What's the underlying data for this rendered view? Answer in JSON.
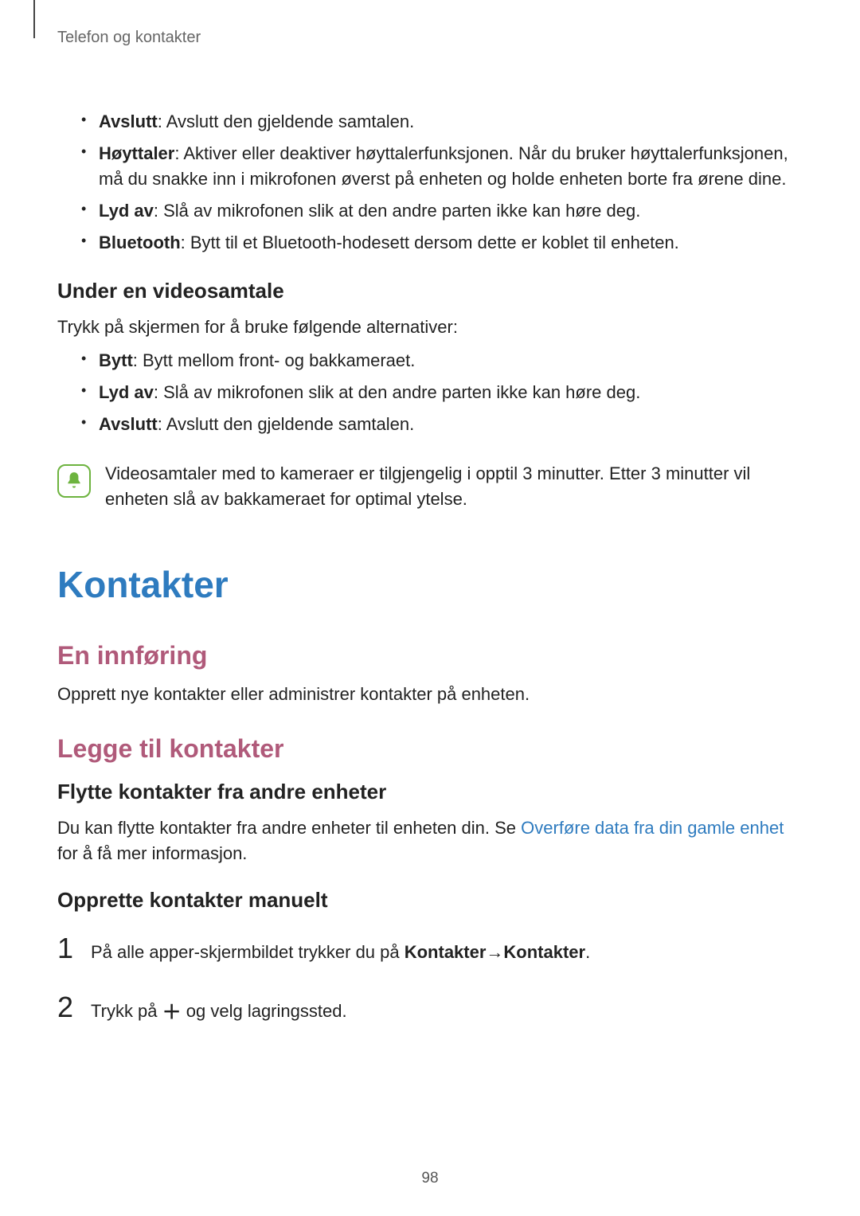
{
  "breadcrumb": "Telefon og kontakter",
  "call_bullets": [
    {
      "bold": "Avslutt",
      "rest": ": Avslutt den gjeldende samtalen."
    },
    {
      "bold": "Høyttaler",
      "rest": ": Aktiver eller deaktiver høyttalerfunksjonen. Når du bruker høyttalerfunksjonen, må du snakke inn i mikrofonen øverst på enheten og holde enheten borte fra ørene dine."
    },
    {
      "bold": "Lyd av",
      "rest": ": Slå av mikrofonen slik at den andre parten ikke kan høre deg."
    },
    {
      "bold": "Bluetooth",
      "rest": ": Bytt til et Bluetooth-hodesett dersom dette er koblet til enheten."
    }
  ],
  "video_heading": "Under en videosamtale",
  "video_intro": "Trykk på skjermen for å bruke følgende alternativer:",
  "video_bullets": [
    {
      "bold": "Bytt",
      "rest": ": Bytt mellom front- og bakkameraet."
    },
    {
      "bold": "Lyd av",
      "rest": ": Slå av mikrofonen slik at den andre parten ikke kan høre deg."
    },
    {
      "bold": "Avslutt",
      "rest": ": Avslutt den gjeldende samtalen."
    }
  ],
  "note_text": "Videosamtaler med to kameraer er tilgjengelig i opptil 3 minutter. Etter 3 minutter vil enheten slå av bakkameraet for optimal ytelse.",
  "title": "Kontakter",
  "intro_heading": "En innføring",
  "intro_body": "Opprett nye kontakter eller administrer kontakter på enheten.",
  "add_heading": "Legge til kontakter",
  "move_heading": "Flytte kontakter fra andre enheter",
  "move_body_pre": "Du kan flytte kontakter fra andre enheter til enheten din. Se ",
  "move_link": "Overføre data fra din gamle enhet",
  "move_body_post": " for å få mer informasjon.",
  "manual_heading": "Opprette kontakter manuelt",
  "step1_pre": "På alle apper-skjermbildet trykker du på ",
  "step1_b1": "Kontakter",
  "step1_arrow": " → ",
  "step1_b2": "Kontakter",
  "step1_post": ".",
  "step2_pre": "Trykk på ",
  "step2_post": " og velg lagringssted.",
  "page_number": "98"
}
